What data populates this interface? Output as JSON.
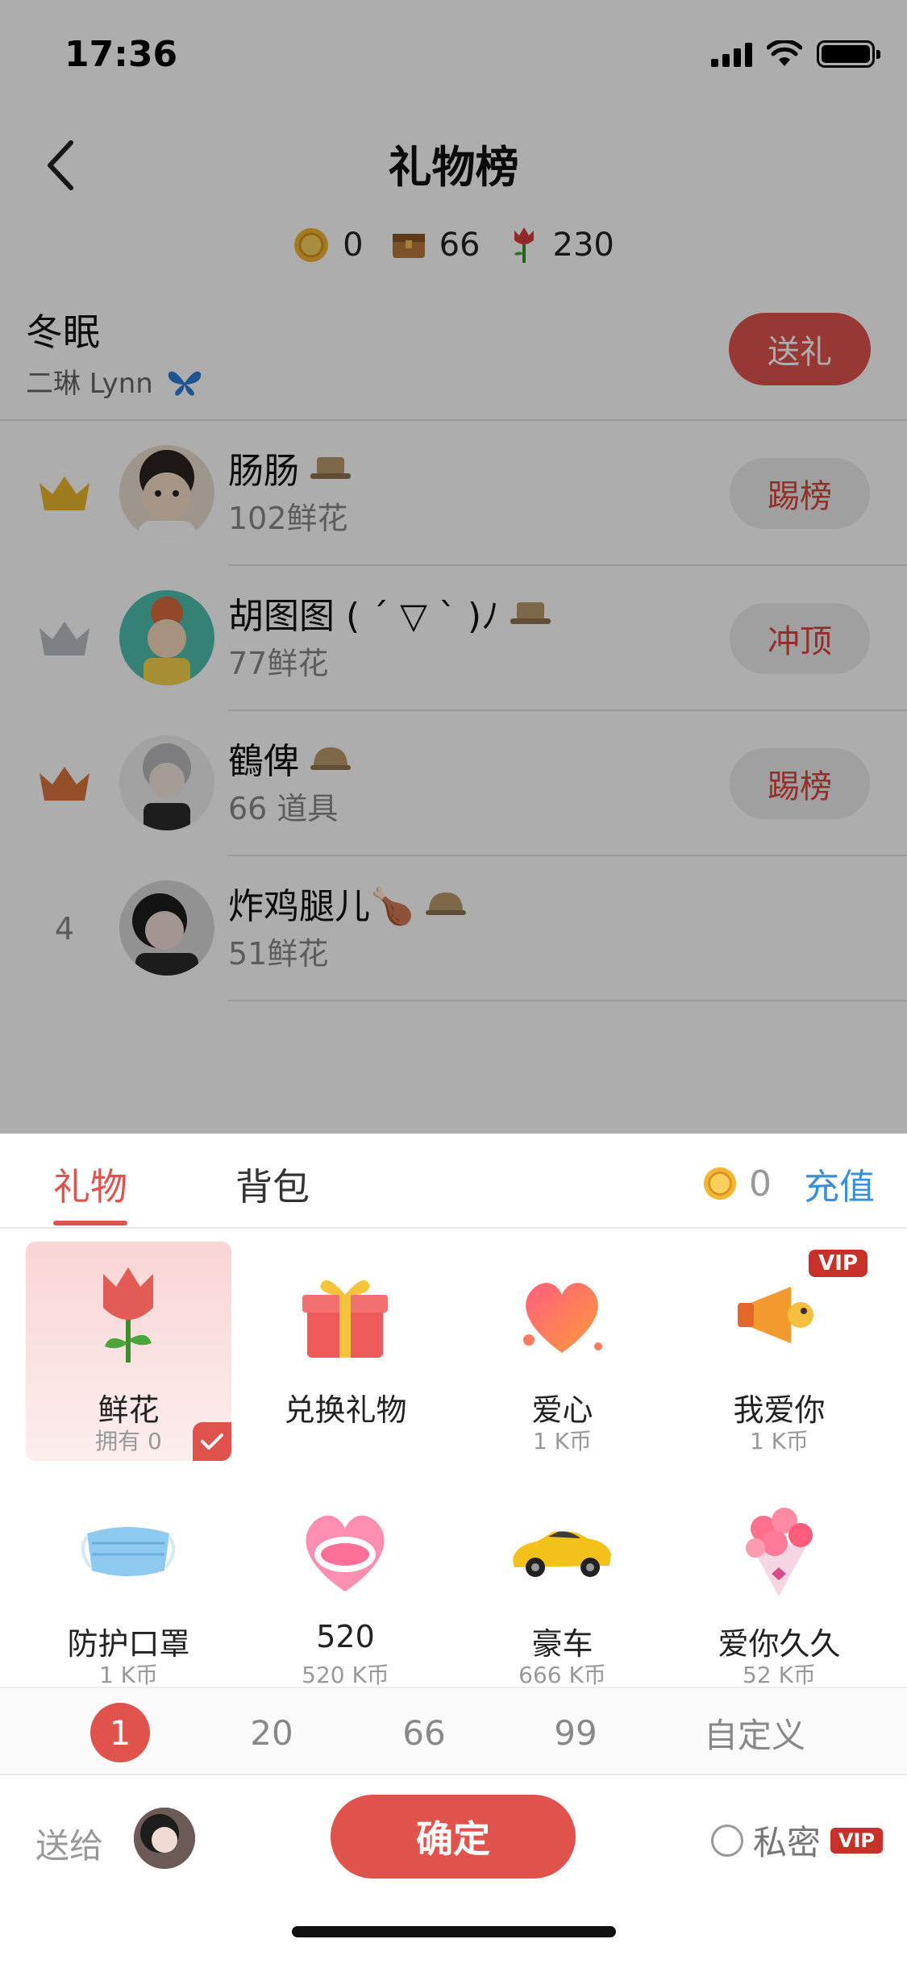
{
  "status_bar": {
    "time": "17:36"
  },
  "nav": {
    "title": "礼物榜"
  },
  "stats": {
    "coins": "0",
    "props": "66",
    "flowers": "230"
  },
  "owner": {
    "name": "冬眠",
    "subtitle": "二琳 Lynn",
    "send_gift_label": "送礼"
  },
  "ranking": [
    {
      "rank": "",
      "crown": "gold",
      "name": "肠肠",
      "sub": "102鲜花",
      "action": "踢榜"
    },
    {
      "rank": "",
      "crown": "silver",
      "name": "胡图图 ( ´ ▽ ` )ﾉ",
      "sub": "77鲜花",
      "action": "冲顶"
    },
    {
      "rank": "",
      "crown": "bronze",
      "name": "鶴俾",
      "sub": "66 道具",
      "action": "踢榜"
    },
    {
      "rank": "4",
      "crown": "",
      "name": "炸鸡腿儿🍗",
      "sub": "51鲜花",
      "action": ""
    }
  ],
  "sheet": {
    "tabs": [
      "礼物",
      "背包"
    ],
    "balance": "0",
    "recharge_label": "充值"
  },
  "gifts": [
    {
      "name": "鲜花",
      "price": "拥有 0",
      "icon": "rose-icon",
      "selected": true
    },
    {
      "name": "兑换礼物",
      "price": "",
      "icon": "gift-box-icon"
    },
    {
      "name": "爱心",
      "price": "1 K币",
      "icon": "heart-icon"
    },
    {
      "name": "我爱你",
      "price": "1 K币",
      "icon": "megaphone-icon",
      "vip": "VIP"
    },
    {
      "name": "防护口罩",
      "price": "1 K币",
      "icon": "mask-icon"
    },
    {
      "name": "520",
      "price": "520 K币",
      "icon": "520-heart-icon"
    },
    {
      "name": "豪车",
      "price": "666 K币",
      "icon": "sports-car-icon"
    },
    {
      "name": "爱你久久",
      "price": "52 K币",
      "icon": "bouquet-icon"
    }
  ],
  "quantities": [
    "1",
    "20",
    "66",
    "99",
    "自定义"
  ],
  "footer": {
    "send_to_label": "送给",
    "confirm_label": "确定",
    "private_label": "私密",
    "vip_label": "VIP"
  },
  "colors": {
    "accent": "#e0534d",
    "link": "#3a8fd8",
    "vip": "#c8302a"
  }
}
